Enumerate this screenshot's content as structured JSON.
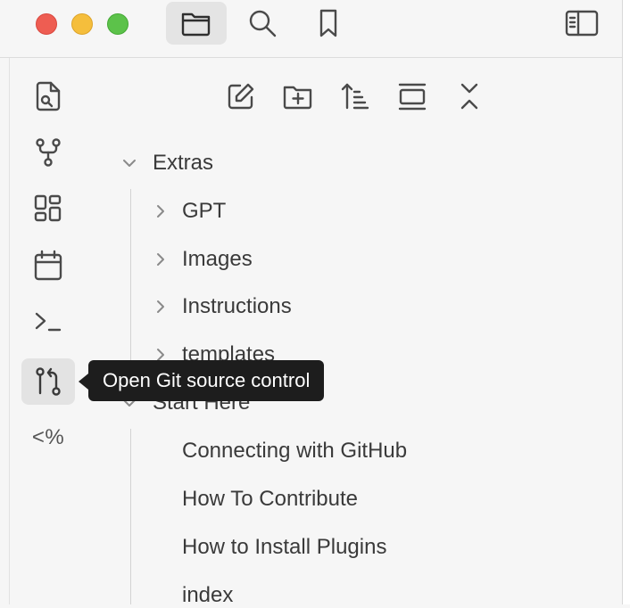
{
  "colors": {
    "close": "#ee5d52",
    "minimize": "#f5be3c",
    "zoom": "#5cc24a",
    "tooltip_bg": "#1d1d1d"
  },
  "titlebar": {
    "tabs": [
      {
        "icon": "folder-icon",
        "active": true
      },
      {
        "icon": "search-icon",
        "active": false
      },
      {
        "icon": "bookmark-icon",
        "active": false
      }
    ],
    "sidebar_toggle_icon": "sidebar-toggle-icon"
  },
  "ribbon": {
    "items": [
      {
        "icon": "file-search-icon"
      },
      {
        "icon": "git-fork-icon"
      },
      {
        "icon": "dashboard-icon"
      },
      {
        "icon": "calendar-icon"
      },
      {
        "icon": "terminal-icon"
      },
      {
        "icon": "git-pull-request-icon",
        "hovered": true
      },
      {
        "icon": "templater-icon",
        "label": "<%"
      }
    ]
  },
  "nav_toolbar": [
    {
      "icon": "new-note-icon"
    },
    {
      "icon": "new-folder-icon"
    },
    {
      "icon": "sort-icon"
    },
    {
      "icon": "auto-reveal-icon"
    },
    {
      "icon": "collapse-all-icon"
    }
  ],
  "tree": {
    "extras": {
      "label": "Extras",
      "expanded": true,
      "children": [
        "GPT",
        "Images",
        "Instructions",
        "templates"
      ]
    },
    "start_here": {
      "label": "Start Here",
      "expanded": true,
      "children": [
        "Connecting with GitHub",
        "How To Contribute",
        "How to Install Plugins",
        "index"
      ]
    }
  },
  "tooltip": {
    "text": "Open Git source control"
  }
}
